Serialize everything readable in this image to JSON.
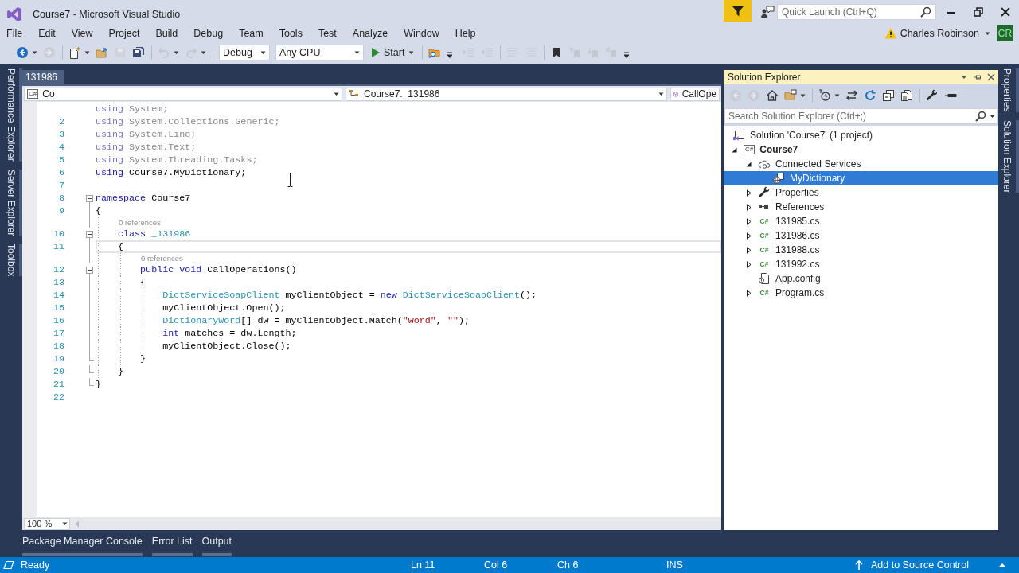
{
  "window": {
    "title": "Course7 - Microsoft Visual Studio",
    "quick_launch": {
      "placeholder": "Quick Launch (Ctrl+Q)"
    },
    "account": {
      "name": "Charles Robinson",
      "initials": "CR"
    }
  },
  "menu": [
    "File",
    "Edit",
    "View",
    "Project",
    "Build",
    "Debug",
    "Team",
    "Tools",
    "Test",
    "Analyze",
    "Window",
    "Help"
  ],
  "toolbar": [
    {
      "kind": "back",
      "disabled": false
    },
    {
      "kind": "caret"
    },
    {
      "kind": "forward",
      "disabled": true
    },
    {
      "kind": "separator"
    },
    {
      "kind": "new-item",
      "disabled": false
    },
    {
      "kind": "caret"
    },
    {
      "kind": "open",
      "disabled": false
    },
    {
      "kind": "save",
      "disabled": true
    },
    {
      "kind": "save-all",
      "disabled": false
    },
    {
      "kind": "separator"
    },
    {
      "kind": "undo",
      "disabled": true
    },
    {
      "kind": "caret"
    },
    {
      "kind": "redo",
      "disabled": true
    },
    {
      "kind": "caret"
    },
    {
      "kind": "separator"
    },
    {
      "kind": "combo",
      "value": "Debug"
    },
    {
      "kind": "combo",
      "value": "Any CPU"
    },
    {
      "kind": "start",
      "label": "Start"
    },
    {
      "kind": "separator"
    },
    {
      "kind": "find",
      "disabled": false
    },
    {
      "kind": "overflow"
    },
    {
      "kind": "indent",
      "disabled": true
    },
    {
      "kind": "outdent",
      "disabled": true
    },
    {
      "kind": "separator"
    },
    {
      "kind": "comment",
      "disabled": true
    },
    {
      "kind": "uncomment",
      "disabled": true
    },
    {
      "kind": "separator"
    },
    {
      "kind": "bookmark",
      "disabled": false
    },
    {
      "kind": "bookmark-previous",
      "disabled": true
    },
    {
      "kind": "bookmark-next",
      "disabled": true
    },
    {
      "kind": "bookmark-clear",
      "disabled": true
    },
    {
      "kind": "overflow"
    }
  ],
  "side_tabs_left": [
    "Performance Explorer",
    "Server Explorer",
    "Toolbox"
  ],
  "editor": {
    "tabs": [
      {
        "label": "131986",
        "selected": true
      }
    ],
    "navigation": {
      "project": {
        "icon_label": "C#",
        "text": "Co"
      },
      "type": "Course7._131986",
      "member": "CallOpe"
    },
    "lines": [
      {
        "kind": "code",
        "collapsible": false,
        "current": false,
        "tokens": [
          {
            "kind": "faded-keyword",
            "text": "using"
          },
          {
            "kind": "faded",
            "text": " System;"
          }
        ]
      },
      {
        "kind": "code",
        "number": "2",
        "collapsible": false,
        "current": false,
        "tokens": [
          {
            "kind": "faded-keyword",
            "text": "using"
          },
          {
            "kind": "faded",
            "text": " System.Collections.Generic;"
          }
        ]
      },
      {
        "kind": "code",
        "number": "3",
        "collapsible": false,
        "current": false,
        "tokens": [
          {
            "kind": "faded-keyword",
            "text": "using"
          },
          {
            "kind": "faded",
            "text": " System.Linq;"
          }
        ]
      },
      {
        "kind": "code",
        "number": "4",
        "collapsible": false,
        "current": false,
        "tokens": [
          {
            "kind": "faded-keyword",
            "text": "using"
          },
          {
            "kind": "faded",
            "text": " System.Text;"
          }
        ]
      },
      {
        "kind": "code",
        "number": "5",
        "collapsible": false,
        "current": false,
        "tokens": [
          {
            "kind": "faded-keyword",
            "text": "using"
          },
          {
            "kind": "faded",
            "text": " System.Threading.Tasks;"
          }
        ]
      },
      {
        "kind": "code",
        "number": "6",
        "collapsible": false,
        "current": false,
        "tokens": [
          {
            "kind": "keyword",
            "text": "using"
          },
          {
            "kind": "plain",
            "text": " Course7.MyDictionary;"
          }
        ]
      },
      {
        "kind": "code",
        "number": "7",
        "collapsible": false,
        "current": false
      },
      {
        "kind": "code",
        "number": "8",
        "collapsible": true,
        "current": false,
        "tokens": [
          {
            "kind": "keyword",
            "text": "namespace"
          },
          {
            "kind": "plain",
            "text": " Course7"
          }
        ]
      },
      {
        "kind": "code",
        "number": "9",
        "collapsible": false,
        "current": false,
        "tokens": [
          {
            "kind": "plain",
            "text": "{"
          }
        ]
      },
      {
        "kind": "codelens",
        "text": "0 references"
      },
      {
        "kind": "code",
        "number": "10",
        "collapsible": true,
        "current": false,
        "tokens": [
          {
            "kind": "keyword",
            "text": "    class"
          },
          {
            "kind": "type",
            "text": " _131986"
          }
        ]
      },
      {
        "kind": "code",
        "number": "11",
        "collapsible": false,
        "current": true,
        "tokens": [
          {
            "kind": "plain",
            "text": "    {"
          }
        ]
      },
      {
        "kind": "codelens",
        "text": "0 references"
      },
      {
        "kind": "code",
        "number": "12",
        "collapsible": true,
        "current": false,
        "tokens": [
          {
            "kind": "keyword",
            "text": "        public void"
          },
          {
            "kind": "plain",
            "text": " CallOperations()"
          }
        ]
      },
      {
        "kind": "code",
        "number": "13",
        "collapsible": false,
        "current": false,
        "tokens": [
          {
            "kind": "plain",
            "text": "        {"
          }
        ]
      },
      {
        "kind": "code",
        "number": "14",
        "collapsible": false,
        "current": false,
        "tokens": [
          {
            "kind": "type",
            "text": "            DictServiceSoapClient"
          },
          {
            "kind": "plain",
            "text": " myClientObject = "
          },
          {
            "kind": "keyword",
            "text": "new"
          },
          {
            "kind": "type",
            "text": " DictServiceSoapClient"
          },
          {
            "kind": "plain",
            "text": "();"
          }
        ]
      },
      {
        "kind": "code",
        "number": "15",
        "collapsible": false,
        "current": false,
        "tokens": [
          {
            "kind": "plain",
            "text": "            myClientObject.Open();"
          }
        ]
      },
      {
        "kind": "code",
        "number": "16",
        "collapsible": false,
        "current": false,
        "tokens": [
          {
            "kind": "type",
            "text": "            DictionaryWord"
          },
          {
            "kind": "plain",
            "text": "[] dw = myClientObject.Match("
          },
          {
            "kind": "string",
            "text": "\"word\""
          },
          {
            "kind": "plain",
            "text": ", "
          },
          {
            "kind": "string",
            "text": "\"\""
          },
          {
            "kind": "plain",
            "text": ");"
          }
        ]
      },
      {
        "kind": "code",
        "number": "17",
        "collapsible": false,
        "current": false,
        "tokens": [
          {
            "kind": "keyword",
            "text": "            int"
          },
          {
            "kind": "plain",
            "text": " matches = dw.Length;"
          }
        ]
      },
      {
        "kind": "code",
        "number": "18",
        "collapsible": false,
        "current": false,
        "tokens": [
          {
            "kind": "plain",
            "text": "            myClientObject.Close();"
          }
        ]
      },
      {
        "kind": "code",
        "number": "19",
        "collapsible": false,
        "current": false,
        "tokens": [
          {
            "kind": "plain",
            "text": "        }"
          }
        ]
      },
      {
        "kind": "code",
        "number": "20",
        "collapsible": false,
        "current": false,
        "tokens": [
          {
            "kind": "plain",
            "text": "    }"
          }
        ]
      },
      {
        "kind": "code",
        "number": "21",
        "collapsible": false,
        "current": false,
        "tokens": [
          {
            "kind": "plain",
            "text": "}"
          }
        ]
      },
      {
        "kind": "code",
        "number": "22",
        "collapsible": false,
        "current": false
      }
    ],
    "zoom": "100 %"
  },
  "solution_explorer": {
    "title": "Solution Explorer",
    "toolbar": [
      {
        "kind": "back",
        "disabled": true
      },
      {
        "kind": "forward",
        "disabled": true
      },
      {
        "kind": "home",
        "disabled": false
      },
      {
        "kind": "switch-views",
        "disabled": false
      },
      {
        "kind": "caret"
      },
      {
        "kind": "separator"
      },
      {
        "kind": "pending-changes",
        "disabled": false
      },
      {
        "kind": "caret"
      },
      {
        "kind": "sync",
        "disabled": false
      },
      {
        "kind": "refresh",
        "disabled": false
      },
      {
        "kind": "collapse-all",
        "disabled": false
      },
      {
        "kind": "show-all-files",
        "disabled": false
      },
      {
        "kind": "separator"
      },
      {
        "kind": "properties",
        "disabled": false
      },
      {
        "kind": "preview",
        "disabled": false
      }
    ],
    "search": {
      "placeholder": "Search Solution Explorer (Ctrl+;)"
    },
    "tree": [
      {
        "kind": "solution",
        "label": "Solution 'Course7' (1 project)",
        "selected": false,
        "children": [
          {
            "kind": "project",
            "icon_label": "C#",
            "label": "Course7",
            "expanded": true,
            "selected": false,
            "children": [
              {
                "kind": "connected-services",
                "label": "Connected Services",
                "expanded": true,
                "selected": false,
                "children": [
                  {
                    "kind": "service",
                    "label": "MyDictionary",
                    "selected": true
                  }
                ]
              },
              {
                "kind": "properties",
                "label": "Properties",
                "expanded": false,
                "selected": false
              },
              {
                "kind": "references",
                "label": "References",
                "expanded": false,
                "selected": false
              },
              {
                "kind": "csharp-file",
                "icon_label": "C#",
                "label": "131985.cs",
                "expanded": false,
                "selected": false
              },
              {
                "kind": "csharp-file",
                "icon_label": "C#",
                "label": "131986.cs",
                "expanded": false,
                "selected": false
              },
              {
                "kind": "csharp-file",
                "icon_label": "C#",
                "label": "131988.cs",
                "expanded": false,
                "selected": false
              },
              {
                "kind": "csharp-file",
                "icon_label": "C#",
                "label": "131992.cs",
                "expanded": false,
                "selected": false
              },
              {
                "kind": "config-file",
                "label": "App.config",
                "selected": false
              },
              {
                "kind": "csharp-file",
                "icon_label": "C#",
                "label": "Program.cs",
                "expanded": false,
                "selected": false
              }
            ]
          }
        ]
      }
    ]
  },
  "side_tabs_right": [
    "Properties",
    "Solution Explorer"
  ],
  "bottom_tabs": [
    {
      "label": "Package Manager Console",
      "selected": false
    },
    {
      "label": "Error List",
      "selected": false
    },
    {
      "label": "Output",
      "selected": false
    }
  ],
  "status_bar": {
    "message": "Ready",
    "line": "Ln 11",
    "column": "Col 6",
    "char": "Ch 6",
    "mode": "INS",
    "source_control": "Add to Source Control"
  }
}
